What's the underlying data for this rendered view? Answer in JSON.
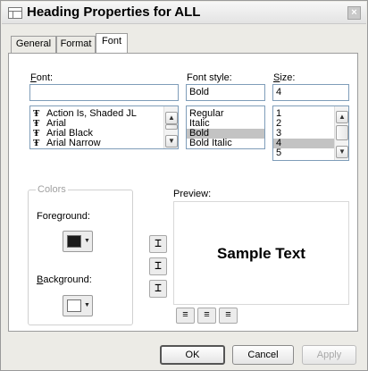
{
  "window": {
    "title": "Heading Properties for ALL",
    "close": "×"
  },
  "tabs": [
    {
      "label": "General"
    },
    {
      "label": "Format"
    },
    {
      "label": "Font"
    }
  ],
  "font": {
    "label_key": "F",
    "label_rest": "ont:",
    "value": "",
    "items": [
      {
        "icon": "Ŧ",
        "label": "Action Is, Shaded JL"
      },
      {
        "icon": "Ŧ",
        "label": "Arial"
      },
      {
        "icon": "Ŧ",
        "label": "Arial Black"
      },
      {
        "icon": "Ŧ",
        "label": "Arial Narrow"
      }
    ]
  },
  "font_style": {
    "label": "Font style:",
    "value": "Bold",
    "items": [
      "Regular",
      "Italic",
      "Bold",
      "Bold Italic"
    ]
  },
  "size": {
    "label_key": "S",
    "label_rest": "ize:",
    "value": "4",
    "items": [
      "1",
      "2",
      "3",
      "4",
      "5"
    ]
  },
  "colors": {
    "group_label": "Colors",
    "foreground_label": "Foreground:",
    "foreground_color": "#1a1a1a",
    "background_label_key": "B",
    "background_label_rest": "ackground:",
    "background_color": "#ffffff"
  },
  "preview": {
    "label": "Preview:",
    "sample_text": "Sample Text"
  },
  "align_glyphs": {
    "v": "⌶",
    "h": "≡"
  },
  "scroll_glyphs": {
    "up": "▲",
    "down": "▼",
    "dropdown": "▼"
  },
  "buttons": {
    "ok": "OK",
    "cancel": "Cancel",
    "apply": "Apply"
  }
}
